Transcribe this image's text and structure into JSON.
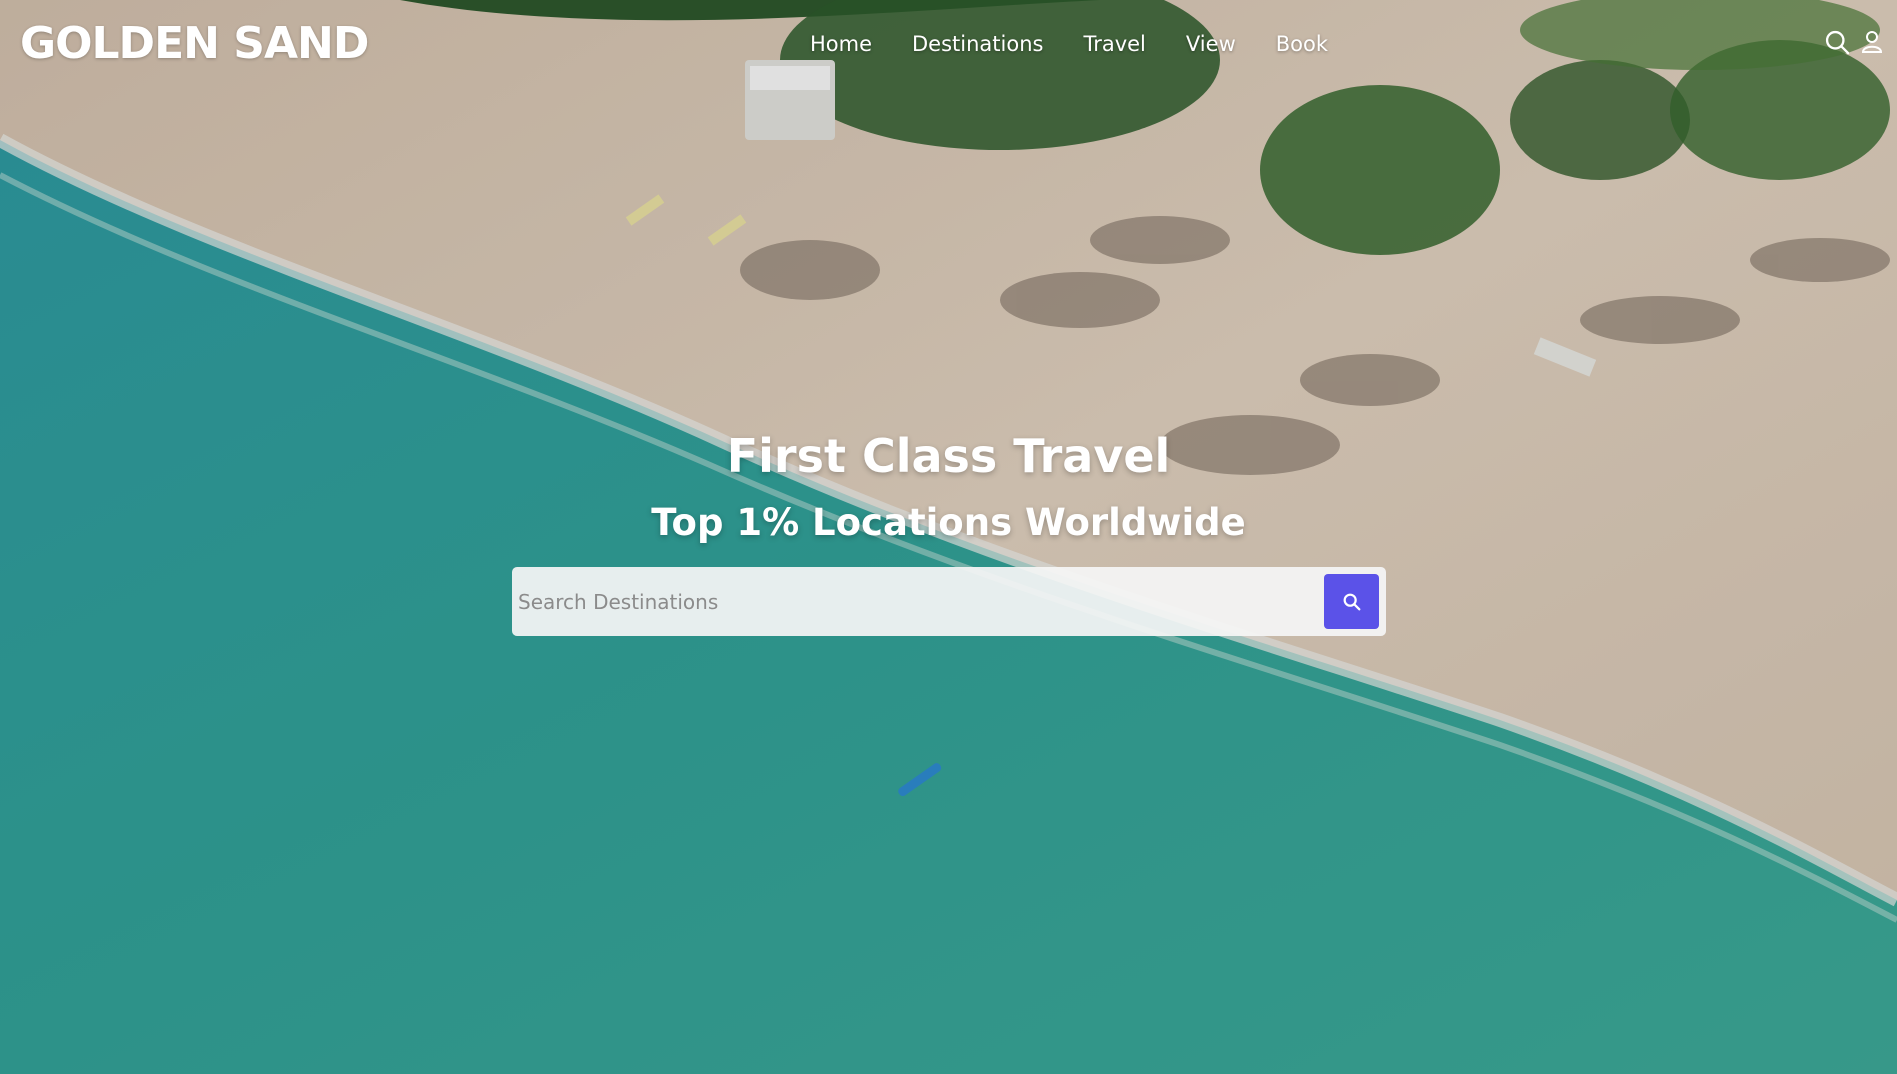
{
  "brand": {
    "logo_text": "GOLDEN SAND"
  },
  "nav": {
    "links": [
      {
        "label": "Home"
      },
      {
        "label": "Destinations"
      },
      {
        "label": "Travel"
      },
      {
        "label": "View"
      },
      {
        "label": "Book"
      }
    ],
    "icons": [
      "search-icon",
      "user-icon"
    ]
  },
  "hero": {
    "title": "First Class Travel",
    "subtitle": "Top 1% Locations Worldwide"
  },
  "search": {
    "placeholder": "Search Destinations",
    "value": "",
    "button_icon": "search-icon"
  },
  "colors": {
    "accent": "#5b52e8",
    "text": "#ffffff",
    "sand": "#e3d1bd",
    "ocean": "#2fa39b"
  }
}
